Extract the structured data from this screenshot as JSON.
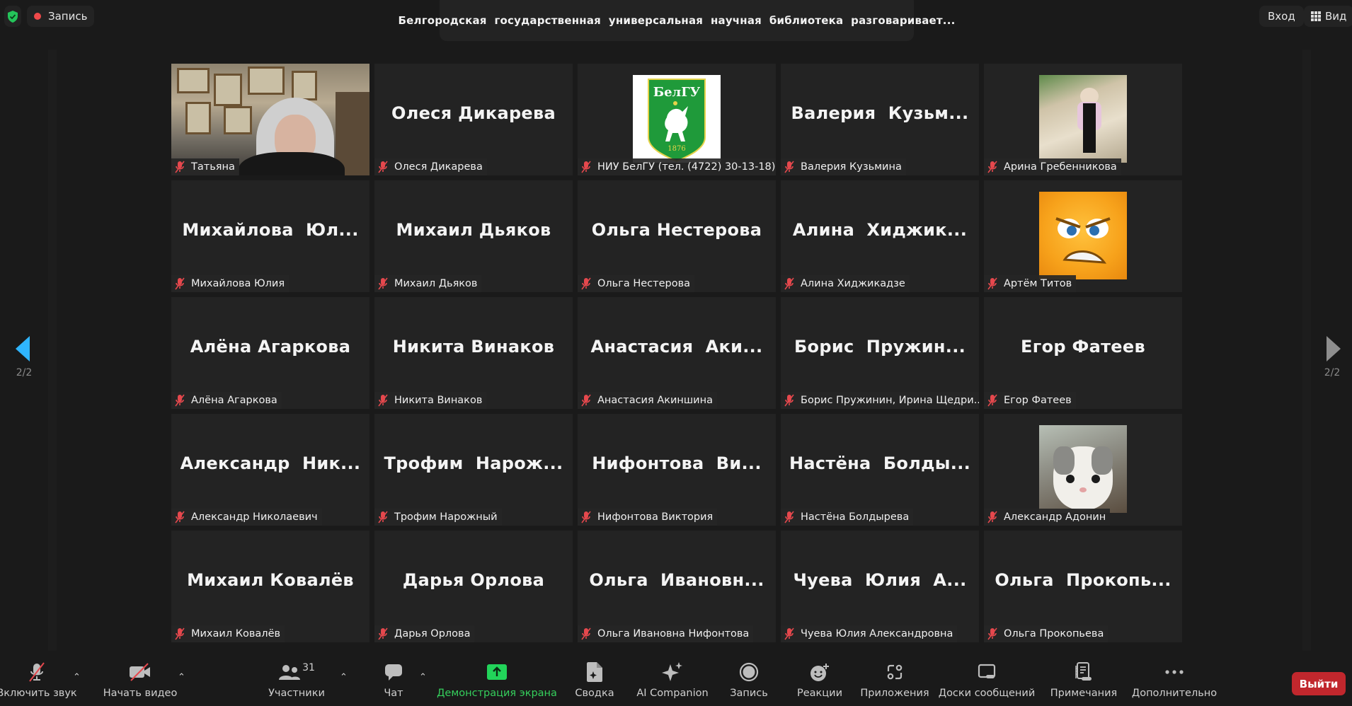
{
  "topbar": {
    "security_icon": "shield-check-icon",
    "recording_label": "Запись",
    "meeting_title": "Белгородская  государственная  универсальная  научная  библиотека  разговаривает...",
    "signin_label": "Вход",
    "view_label": "Вид",
    "view_icon": "grid-icon"
  },
  "colors": {
    "background": "#1a1a1a",
    "tile": "#232323",
    "recording_dot": "#f0494a",
    "share_green": "#22d45a",
    "leave_red": "#c1272d",
    "nav_active": "#2fb5ff",
    "muted_red": "#e5484d"
  },
  "pagination": {
    "left_page": "2/2",
    "right_page": "2/2"
  },
  "participants": [
    {
      "display": "",
      "label": "Татьяна",
      "media": "video",
      "muted": true
    },
    {
      "display": "Олеся Дикарева",
      "label": "Олеся Дикарева",
      "media": "name",
      "muted": true
    },
    {
      "display": "",
      "label": "НИУ БелГУ (тел. (4722) 30-13-18)",
      "media": "avatar-belgu",
      "muted": true,
      "avatar_text": "БелГУ",
      "avatar_year": "1876"
    },
    {
      "display": "Валерия  Кузьм...",
      "label": "Валерия Кузьмина",
      "media": "name",
      "muted": true
    },
    {
      "display": "",
      "label": "Арина Гребенникова",
      "media": "avatar-photo",
      "muted": true
    },
    {
      "display": "Михайлова  Юл...",
      "label": "Михайлова Юлия",
      "media": "name",
      "muted": true
    },
    {
      "display": "Михаил Дьяков",
      "label": "Михаил Дьяков",
      "media": "name",
      "muted": true
    },
    {
      "display": "Ольга Нестерова",
      "label": "Ольга Нестерова",
      "media": "name",
      "muted": true
    },
    {
      "display": "Алина  Хиджик...",
      "label": "Алина Хиджикадзе",
      "media": "name",
      "muted": true
    },
    {
      "display": "",
      "label": "Артём Титов",
      "media": "avatar-angry",
      "muted": true
    },
    {
      "display": "Алёна Агаркова",
      "label": "Алёна Агаркова",
      "media": "name",
      "muted": true
    },
    {
      "display": "Никита Винаков",
      "label": "Никита Винаков",
      "media": "name",
      "muted": true
    },
    {
      "display": "Анастасия  Аки...",
      "label": "Анастасия Акиншина",
      "media": "name",
      "muted": true
    },
    {
      "display": "Борис  Пружин...",
      "label": "Борис Пружинин, Ирина Щедри...",
      "media": "name",
      "muted": true
    },
    {
      "display": "Егор Фатеев",
      "label": "Егор Фатеев",
      "media": "name",
      "muted": true
    },
    {
      "display": "Александр  Ник...",
      "label": "Александр Николаевич",
      "media": "name",
      "muted": true
    },
    {
      "display": "Трофим  Нарож...",
      "label": "Трофим Нарожный",
      "media": "name",
      "muted": true
    },
    {
      "display": "Нифонтова  Ви...",
      "label": "Нифонтова Виктория",
      "media": "name",
      "muted": true
    },
    {
      "display": "Настёна  Болды...",
      "label": "Настёна Болдырева",
      "media": "name",
      "muted": true
    },
    {
      "display": "",
      "label": "Александр Адонин",
      "media": "avatar-kitten",
      "muted": true
    },
    {
      "display": "Михаил Ковалёв",
      "label": "Михаил Ковалёв",
      "media": "name",
      "muted": true
    },
    {
      "display": "Дарья Орлова",
      "label": "Дарья Орлова",
      "media": "name",
      "muted": true
    },
    {
      "display": "Ольга  Ивановн...",
      "label": "Ольга Ивановна Нифонтова",
      "media": "name",
      "muted": true
    },
    {
      "display": "Чуева  Юлия  А...",
      "label": "Чуева Юлия Александровна",
      "media": "name",
      "muted": true
    },
    {
      "display": "Ольга  Прокопь...",
      "label": "Ольга Прокопьева",
      "media": "name",
      "muted": true
    }
  ],
  "toolbar": {
    "unmute": "Включить звук",
    "start_video": "Начать видео",
    "participants": "Участники",
    "participants_count": "31",
    "chat": "Чат",
    "share_screen": "Демонстрация экрана",
    "summary": "Сводка",
    "ai_companion": "AI Companion",
    "record": "Запись",
    "reactions": "Реакции",
    "apps": "Приложения",
    "whiteboards": "Доски сообщений",
    "notes": "Примечания",
    "more": "Дополнительно",
    "leave": "Выйти"
  }
}
